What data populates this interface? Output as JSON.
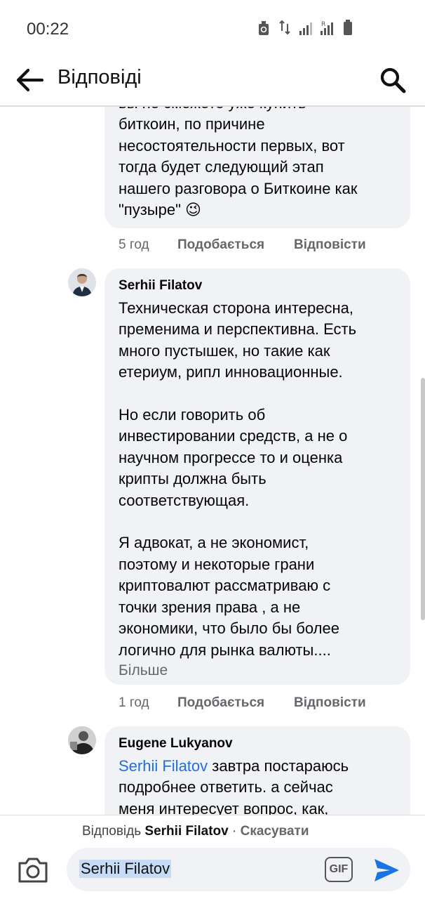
{
  "status_bar": {
    "time": "00:22",
    "icons": [
      "recycle-icon",
      "data-arrows-icon",
      "signal-icon",
      "signal-r-icon",
      "battery-icon"
    ]
  },
  "header": {
    "title": "Відповіді",
    "back_icon": "arrow-left-icon",
    "search_icon": "search-icon"
  },
  "comments": [
    {
      "author": "",
      "text_partial_top": "вы не сможете уже купить",
      "text": "биткоин, по причине\nнесостоятельности первых, вот\nтогда будет следующий этап\nнашего разговора о Биткоине как\n\"пузыре\"",
      "emoji": "😉",
      "time": "5 год",
      "like_label": "Подобається",
      "reply_label": "Відповісти"
    },
    {
      "author": "Serhii Filatov",
      "text": "Техническая сторона интересна,\nпременима и перспективна. Есть\nмного пустышек, но такие как\nетериум, рипл инновационные.\n\nНо если говорить об\nинвестировании средств, а не о\nнаучном прогрессе то и оценка\nкрипты должна быть\nсоответствующая.\n\nЯ адвокат, а не экономист,\nпоэтому и некоторые грани\nкриптовалют рассматриваю с\nточки зрения права , а не\nэкономики, что было бы более\nлогично для рынка валюты....",
      "more_label": "Більше",
      "time": "1 год",
      "like_label": "Подобається",
      "reply_label": "Відповісти"
    },
    {
      "author": "Eugene Lukyanov",
      "mention": "Serhii Filatov",
      "text_after_mention": " завтра постараюсь\nподробнее ответить.  а сейчас\nменя интересует вопрос, как,"
    }
  ],
  "reply_bar": {
    "prefix": "Відповідь",
    "target": "Serhii Filatov",
    "separator": "·",
    "cancel": "Скасувати",
    "input_value": "Serhii Filatov",
    "gif_label": "GIF",
    "camera_icon": "camera-icon",
    "send_icon": "send-icon"
  },
  "colors": {
    "bubble": "#f0f2f5",
    "mention": "#216fdb",
    "send": "#1b74e4",
    "muted": "#65676b"
  }
}
